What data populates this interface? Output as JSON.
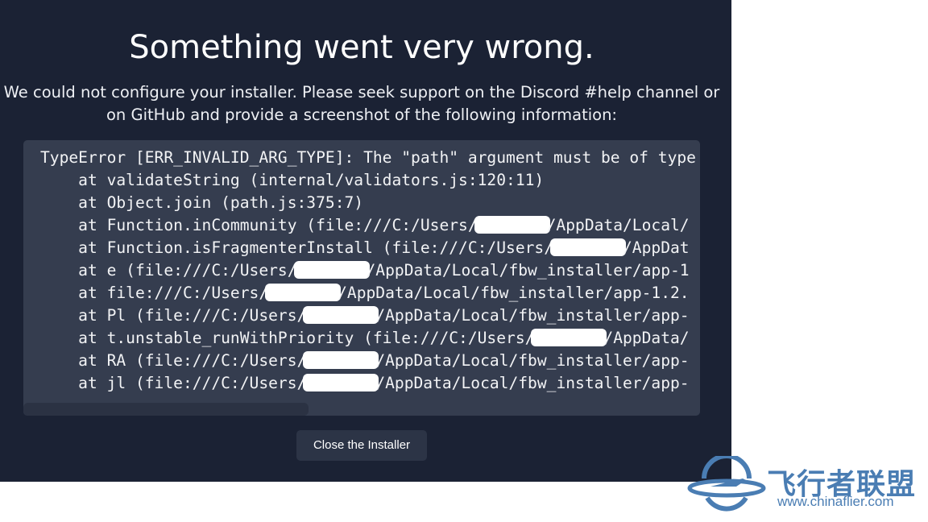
{
  "title": "Something went very wrong.",
  "description": "We could not configure your installer. Please seek support on the Discord #help channel or on GitHub and provide a screenshot of the following information:",
  "error_lines": [
    {
      "pre": "TypeError [ERR_INVALID_ARG_TYPE]: The \"path\" argument must be of type",
      "post": ""
    },
    {
      "pre": "    at validateString (internal/validators.js:120:11)",
      "post": ""
    },
    {
      "pre": "    at Object.join (path.js:375:7)",
      "post": ""
    },
    {
      "pre": "    at Function.inCommunity (file:///C:/Users/",
      "post": "/AppData/Local/"
    },
    {
      "pre": "    at Function.isFragmenterInstall (file:///C:/Users/",
      "post": "/AppDat"
    },
    {
      "pre": "    at e (file:///C:/Users/",
      "post": "/AppData/Local/fbw_installer/app-1"
    },
    {
      "pre": "    at file:///C:/Users/",
      "post": "/AppData/Local/fbw_installer/app-1.2."
    },
    {
      "pre": "    at Pl (file:///C:/Users/",
      "post": "/AppData/Local/fbw_installer/app-"
    },
    {
      "pre": "    at t.unstable_runWithPriority (file:///C:/Users/",
      "post": "/AppData/"
    },
    {
      "pre": "    at RA (file:///C:/Users/",
      "post": "/AppData/Local/fbw_installer/app-"
    },
    {
      "pre": "    at jl (file:///C:/Users/",
      "post": "/AppData/Local/fbw_installer/app-"
    }
  ],
  "close_button": "Close the Installer",
  "watermark": {
    "name": "飞行者联盟",
    "url": "www.chinaflier.com",
    "color": "#4a7db3"
  }
}
